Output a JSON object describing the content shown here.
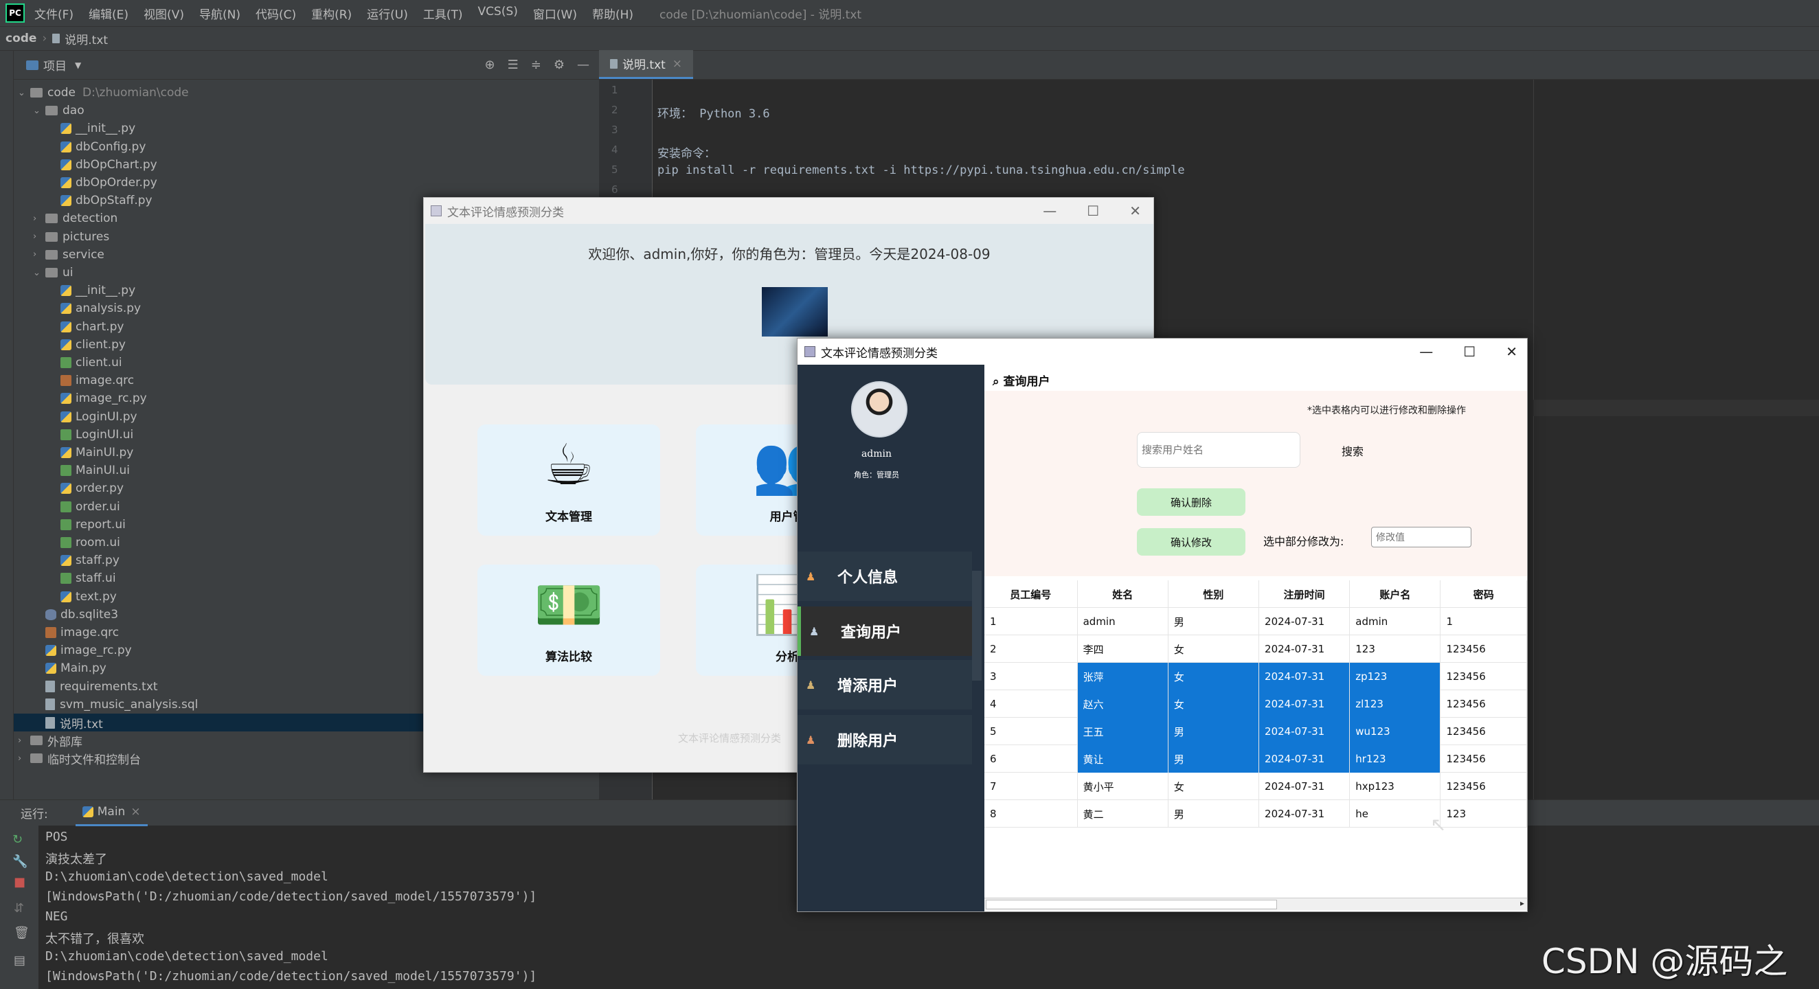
{
  "ide": {
    "menu": [
      "文件(F)",
      "编辑(E)",
      "视图(V)",
      "导航(N)",
      "代码(C)",
      "重构(R)",
      "运行(U)",
      "工具(T)",
      "VCS(S)",
      "窗口(W)",
      "帮助(H)"
    ],
    "window_title": "code [D:\\zhuomian\\code] - 说明.txt",
    "logo": "PC",
    "breadcrumb": [
      "code",
      "说明.txt"
    ],
    "project_label": "项目",
    "tree": [
      {
        "name": "code",
        "hint": "D:\\zhuomian\\code",
        "type": "folder",
        "open": true
      },
      {
        "name": "dao",
        "type": "folder",
        "open": true
      },
      {
        "name": "__init__.py",
        "type": "py"
      },
      {
        "name": "dbConfig.py",
        "type": "py"
      },
      {
        "name": "dbOpChart.py",
        "type": "py"
      },
      {
        "name": "dbOpOrder.py",
        "type": "py"
      },
      {
        "name": "dbOpStaff.py",
        "type": "py"
      },
      {
        "name": "detection",
        "type": "folder",
        "open": false
      },
      {
        "name": "pictures",
        "type": "folder",
        "open": false
      },
      {
        "name": "service",
        "type": "folder",
        "open": false
      },
      {
        "name": "ui",
        "type": "folder",
        "open": true
      },
      {
        "name": "__init__.py",
        "type": "py"
      },
      {
        "name": "analysis.py",
        "type": "py"
      },
      {
        "name": "chart.py",
        "type": "py"
      },
      {
        "name": "client.py",
        "type": "py"
      },
      {
        "name": "client.ui",
        "type": "ui"
      },
      {
        "name": "image.qrc",
        "type": "qrc"
      },
      {
        "name": "image_rc.py",
        "type": "py"
      },
      {
        "name": "LoginUI.py",
        "type": "py"
      },
      {
        "name": "LoginUI.ui",
        "type": "ui"
      },
      {
        "name": "MainUI.py",
        "type": "py"
      },
      {
        "name": "MainUI.ui",
        "type": "ui"
      },
      {
        "name": "order.py",
        "type": "py"
      },
      {
        "name": "order.ui",
        "type": "ui"
      },
      {
        "name": "report.ui",
        "type": "ui"
      },
      {
        "name": "room.ui",
        "type": "ui"
      },
      {
        "name": "staff.py",
        "type": "py"
      },
      {
        "name": "staff.ui",
        "type": "ui"
      },
      {
        "name": "text.py",
        "type": "py"
      },
      {
        "name": "db.sqlite3",
        "type": "db"
      },
      {
        "name": "image.qrc",
        "type": "qrc"
      },
      {
        "name": "image_rc.py",
        "type": "py"
      },
      {
        "name": "Main.py",
        "type": "py"
      },
      {
        "name": "requirements.txt",
        "type": "txt"
      },
      {
        "name": "svm_music_analysis.sql",
        "type": "txt"
      },
      {
        "name": "说明.txt",
        "type": "txt",
        "selected": true
      },
      {
        "name": "外部库",
        "type": "folder",
        "open": false
      },
      {
        "name": "临时文件和控制台",
        "type": "folder",
        "open": false
      }
    ],
    "editor_tab": "说明.txt",
    "code_lines": [
      "",
      "环境： Python 3.6",
      "",
      "安装命令：",
      "pip install -r requirements.txt -i https://pypi.tuna.tsinghua.edu.cn/simple",
      ""
    ],
    "run_label": "运行:",
    "run_tab": "Main",
    "console": [
      "POS",
      "演技太差了",
      "D:\\zhuomian\\code\\detection\\saved_model",
      "[WindowsPath('D:/zhuomian/code/detection/saved_model/1557073579')]",
      "NEG",
      "太不错了，很喜欢",
      "D:\\zhuomian\\code\\detection\\saved_model",
      "[WindowsPath('D:/zhuomian/code/detection/saved_model/1557073579')]"
    ]
  },
  "back_window": {
    "title": "文本评论情感预测分类",
    "welcome": "欢迎你、admin,你好，你的角色为：管理员。今天是2024-08-09",
    "cards": [
      {
        "label": "文本管理",
        "icon": "coffee-cup-icon",
        "glyph": "☕"
      },
      {
        "label": "用户管",
        "icon": "users-icon",
        "glyph": "👥"
      },
      {
        "label": "算法比较",
        "icon": "money-wallet-icon",
        "glyph": "💵"
      },
      {
        "label": "分析",
        "icon": "bar-chart-icon",
        "glyph": "📊"
      }
    ],
    "footer": "文本评论情感预测分类"
  },
  "front_window": {
    "title": "文本评论情感预测分类",
    "username": "admin",
    "role": "角色：管理员",
    "menu": [
      "个人信息",
      "查询用户",
      "增添用户",
      "删除用户"
    ],
    "active_menu": 1,
    "content_title": "查询用户",
    "hint": "*选中表格内可以进行修改和删除操作",
    "search_placeholder": "搜索用户姓名",
    "search_button": "搜索",
    "delete_button": "确认删除",
    "modify_button": "确认修改",
    "modify_label": "选中部分修改为:",
    "modify_placeholder": "修改值",
    "table": {
      "headers": [
        "员工编号",
        "姓名",
        "性别",
        "注册时间",
        "账户名",
        "密码"
      ],
      "rows": [
        [
          "1",
          "admin",
          "男",
          "2024-07-31",
          "admin",
          "1"
        ],
        [
          "2",
          "李四",
          "女",
          "2024-07-31",
          "123",
          "123456"
        ],
        [
          "3",
          "张萍",
          "女",
          "2024-07-31",
          "zp123",
          "123456"
        ],
        [
          "4",
          "赵六",
          "女",
          "2024-07-31",
          "zl123",
          "123456"
        ],
        [
          "5",
          "王五",
          "男",
          "2024-07-31",
          "wu123",
          "123456"
        ],
        [
          "6",
          "黄让",
          "男",
          "2024-07-31",
          "hr123",
          "123456"
        ],
        [
          "7",
          "黄小平",
          "女",
          "2024-07-31",
          "hxp123",
          "123456"
        ],
        [
          "8",
          "黄二",
          "男",
          "2024-07-31",
          "he",
          "123"
        ]
      ],
      "selected_rows": [
        2,
        3,
        4,
        5
      ],
      "selected_cols": [
        1,
        2,
        3,
        4
      ]
    }
  },
  "watermark": "CSDN @源码之家"
}
